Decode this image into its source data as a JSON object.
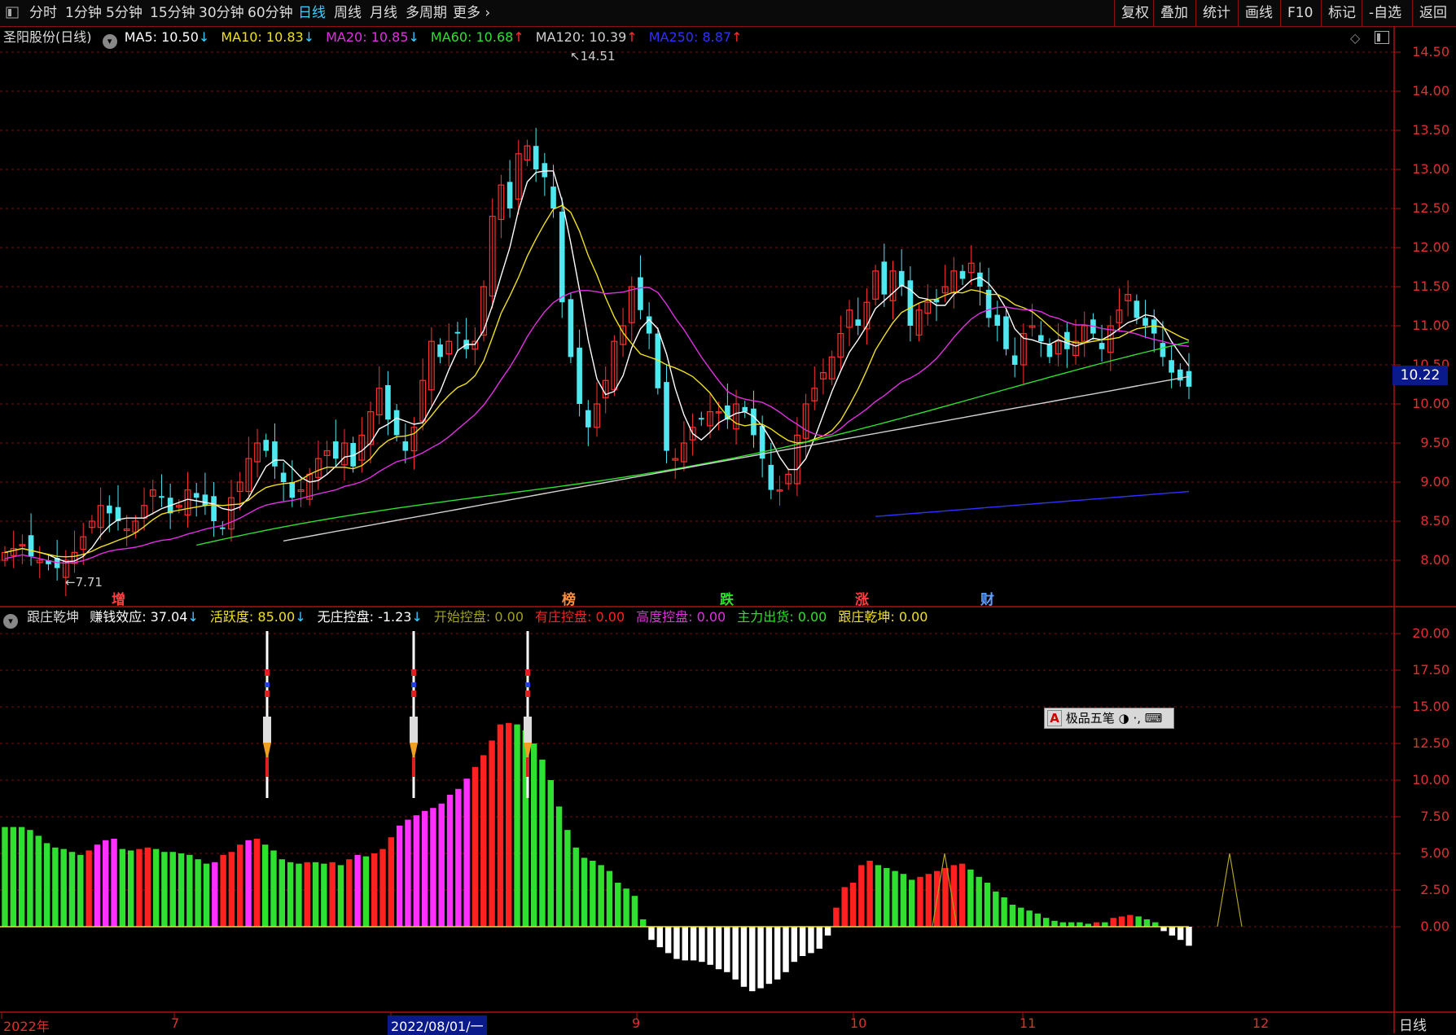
{
  "toolbar": {
    "tabs": [
      "分时",
      "1分钟",
      "5分钟",
      "15分钟",
      "30分钟",
      "60分钟",
      "日线",
      "周线",
      "月线",
      "多周期",
      "更多"
    ],
    "active_tab": "日线",
    "right_buttons": [
      "复权",
      "叠加",
      "统计",
      "画线",
      "F10",
      "标记",
      "-自选",
      "返回"
    ]
  },
  "main_legend": {
    "stock": "圣阳股份(日线)",
    "ma": [
      {
        "label": "MA5: 10.50",
        "arrow": "↓",
        "color": "#ffffff",
        "arrow_color": "#3cd0ff"
      },
      {
        "label": "MA10: 10.83",
        "arrow": "↓",
        "color": "#f0e020",
        "arrow_color": "#3cd0ff"
      },
      {
        "label": "MA20: 10.85",
        "arrow": "↓",
        "color": "#e030e0",
        "arrow_color": "#3cd0ff"
      },
      {
        "label": "MA60: 10.68",
        "arrow": "↑",
        "color": "#30e030",
        "arrow_color": "#ff3030"
      },
      {
        "label": "MA120: 10.39",
        "arrow": "↑",
        "color": "#d0d0d0",
        "arrow_color": "#ff3030"
      },
      {
        "label": "MA250: 8.87",
        "arrow": "↑",
        "color": "#3030ff",
        "arrow_color": "#ff3030"
      }
    ]
  },
  "price_axis": [
    "14.50",
    "14.00",
    "13.50",
    "13.00",
    "12.50",
    "12.00",
    "11.50",
    "11.00",
    "10.50",
    "10.00",
    "9.50",
    "9.00",
    "8.50",
    "8.00"
  ],
  "current_price": "10.22",
  "annotations": {
    "high": "14.51",
    "low": "7.71"
  },
  "event_tags": [
    {
      "text": "增",
      "color": "#ff4040"
    },
    {
      "text": "榜",
      "color": "#ff9040"
    },
    {
      "text": "跌",
      "color": "#30e030"
    },
    {
      "text": "涨",
      "color": "#ff4040"
    },
    {
      "text": "财",
      "color": "#60a0ff"
    }
  ],
  "indicator_legend": {
    "name": "跟庄乾坤",
    "items": [
      {
        "label": "赚钱效应: 37.04",
        "arrow": "↓",
        "color": "#ffffff"
      },
      {
        "label": "活跃度: 85.00",
        "arrow": "↓",
        "color": "#f0e020"
      },
      {
        "label": "无庄控盘: -1.23",
        "arrow": "↓",
        "color": "#ffffff"
      },
      {
        "label": "开始控盘: 0.00",
        "arrow": "",
        "color": "#a0a020"
      },
      {
        "label": "有庄控盘: 0.00",
        "arrow": "",
        "color": "#ff2020"
      },
      {
        "label": "高度控盘: 0.00",
        "arrow": "",
        "color": "#e030e0"
      },
      {
        "label": "主力出货: 0.00",
        "arrow": "",
        "color": "#30e030"
      },
      {
        "label": "跟庄乾坤: 0.00",
        "arrow": "",
        "color": "#f0e020"
      }
    ]
  },
  "indicator_axis": [
    "20.00",
    "17.50",
    "15.00",
    "12.50",
    "10.00",
    "7.50",
    "5.00",
    "2.50",
    "0.00"
  ],
  "date_axis": [
    "2022年",
    "7",
    "2022/08/01/一",
    "9",
    "10",
    "11",
    "12"
  ],
  "period_label": "日线",
  "ime": {
    "label": "极品五笔"
  },
  "chart_data": {
    "type": "bar",
    "indicator_values": [
      6.8,
      6.8,
      6.8,
      6.6,
      6.2,
      5.7,
      5.4,
      5.3,
      5.1,
      4.9,
      5.2,
      5.6,
      5.9,
      6.0,
      5.3,
      5.2,
      5.3,
      5.4,
      5.3,
      5.1,
      5.1,
      5.0,
      4.9,
      4.6,
      4.3,
      4.4,
      4.9,
      5.1,
      5.6,
      5.9,
      6.0,
      5.6,
      5.2,
      4.6,
      4.4,
      4.3,
      4.4,
      4.4,
      4.3,
      4.4,
      4.2,
      4.6,
      4.9,
      4.8,
      5.0,
      5.3,
      6.1,
      6.9,
      7.3,
      7.6,
      7.9,
      8.1,
      8.4,
      9.0,
      9.4,
      10.1,
      10.9,
      11.7,
      12.7,
      13.8,
      13.9,
      13.8,
      13.4,
      12.5,
      11.4,
      10.0,
      8.2,
      6.6,
      5.4,
      4.7,
      4.5,
      4.2,
      3.8,
      3.0,
      2.6,
      2.1,
      0.5,
      -0.9,
      -1.4,
      -1.8,
      -2.2,
      -2.3,
      -2.3,
      -2.4,
      -2.6,
      -2.9,
      -3.1,
      -3.6,
      -4.1,
      -4.4,
      -4.2,
      -3.9,
      -3.6,
      -3.1,
      -2.4,
      -2.0,
      -1.8,
      -1.5,
      -0.6,
      1.3,
      2.7,
      3.0,
      4.2,
      4.5,
      4.2,
      4.0,
      3.8,
      3.6,
      3.2,
      3.4,
      3.6,
      3.8,
      4.0,
      4.2,
      4.3,
      3.9,
      3.4,
      3.0,
      2.4,
      2.0,
      1.5,
      1.3,
      1.1,
      0.9,
      0.6,
      0.4,
      0.3,
      0.3,
      0.3,
      0.2,
      0.3,
      0.3,
      0.6,
      0.7,
      0.8,
      0.7,
      0.5,
      0.3,
      -0.3,
      -0.6,
      -0.9,
      -1.3
    ],
    "ylim": [
      -4.5,
      20
    ]
  }
}
